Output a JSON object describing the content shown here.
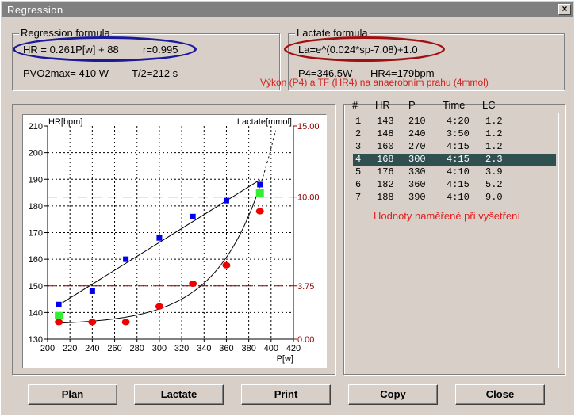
{
  "window": {
    "title": "Regression",
    "close_glyph": "×"
  },
  "regression": {
    "title": "Regression formula",
    "formula": "HR = 0.261P[w] + 88",
    "r": "r=0.995",
    "pvo2": "PVO2max= 410 W",
    "t2": "T/2=212 s"
  },
  "lactate": {
    "title": "Lactate formula",
    "formula": "La=e^(0.024*sp-7.08)+1.0",
    "p4": "P4=346.5W",
    "hr4": "HR4=179bpm",
    "note": "Výkon (P4) a TF (HR4)  na anaerobním prahu (4mmol)"
  },
  "table": {
    "headers": [
      "#",
      "HR",
      "P",
      "Time",
      "LC"
    ],
    "rows": [
      [
        "1",
        "143",
        "210",
        "4:20",
        "1.2"
      ],
      [
        "2",
        "148",
        "240",
        "3:50",
        "1.2"
      ],
      [
        "3",
        "160",
        "270",
        "4:15",
        "1.2"
      ],
      [
        "4",
        "168",
        "300",
        "4:15",
        "2.3"
      ],
      [
        "5",
        "176",
        "330",
        "4:10",
        "3.9"
      ],
      [
        "6",
        "182",
        "360",
        "4:15",
        "5.2"
      ],
      [
        "7",
        "188",
        "390",
        "4:10",
        "9.0"
      ]
    ],
    "selected_index": 3,
    "note": "Hodnoty naměřené při vyšetření"
  },
  "buttons": {
    "plan": "Plan",
    "lactate": "Lactate",
    "print": "Print",
    "copy": "Copy",
    "close": "Close"
  },
  "colors": {
    "hr_points": "#0000ee",
    "lactate_points": "#ee0000",
    "threshold_lines": "#8b0000",
    "highlight": "#33ee33",
    "selected_row": "#305050"
  },
  "chart_data": {
    "type": "scatter",
    "xlabel": "P[w]",
    "ylabel_left": "HR[bpm]",
    "ylabel_right": "Lactate[mmol]",
    "xlim": [
      200,
      420
    ],
    "ylim_left": [
      130,
      210
    ],
    "ylim_right": [
      0,
      15
    ],
    "x_ticks": [
      200,
      220,
      240,
      260,
      280,
      300,
      320,
      340,
      360,
      380,
      400,
      420
    ],
    "y_ticks_left": [
      130,
      140,
      150,
      160,
      170,
      180,
      190,
      200,
      210
    ],
    "y_ticks_right": [
      "0.00",
      "3.75",
      "10.00",
      "15.00"
    ],
    "series": [
      {
        "name": "HR",
        "x": [
          210,
          240,
          270,
          300,
          330,
          360,
          390
        ],
        "y": [
          143,
          148,
          160,
          168,
          176,
          182,
          188
        ]
      },
      {
        "name": "Lactate",
        "x": [
          210,
          240,
          270,
          300,
          330,
          360,
          390
        ],
        "y": [
          1.2,
          1.2,
          1.2,
          2.3,
          3.9,
          5.2,
          9.0
        ]
      }
    ],
    "threshold_lines_right": [
      3.75,
      10.0
    ],
    "highlight_points": [
      {
        "x": 210,
        "hr": 139,
        "lac": 1.2
      },
      {
        "x": 390,
        "hr": 185,
        "lac": 9.0
      }
    ],
    "hr_fit": {
      "slope": 0.261,
      "intercept": 88
    },
    "lactate_fit": {
      "a": 0.024,
      "b": -7.08,
      "c": 1.0
    },
    "grid": true
  }
}
